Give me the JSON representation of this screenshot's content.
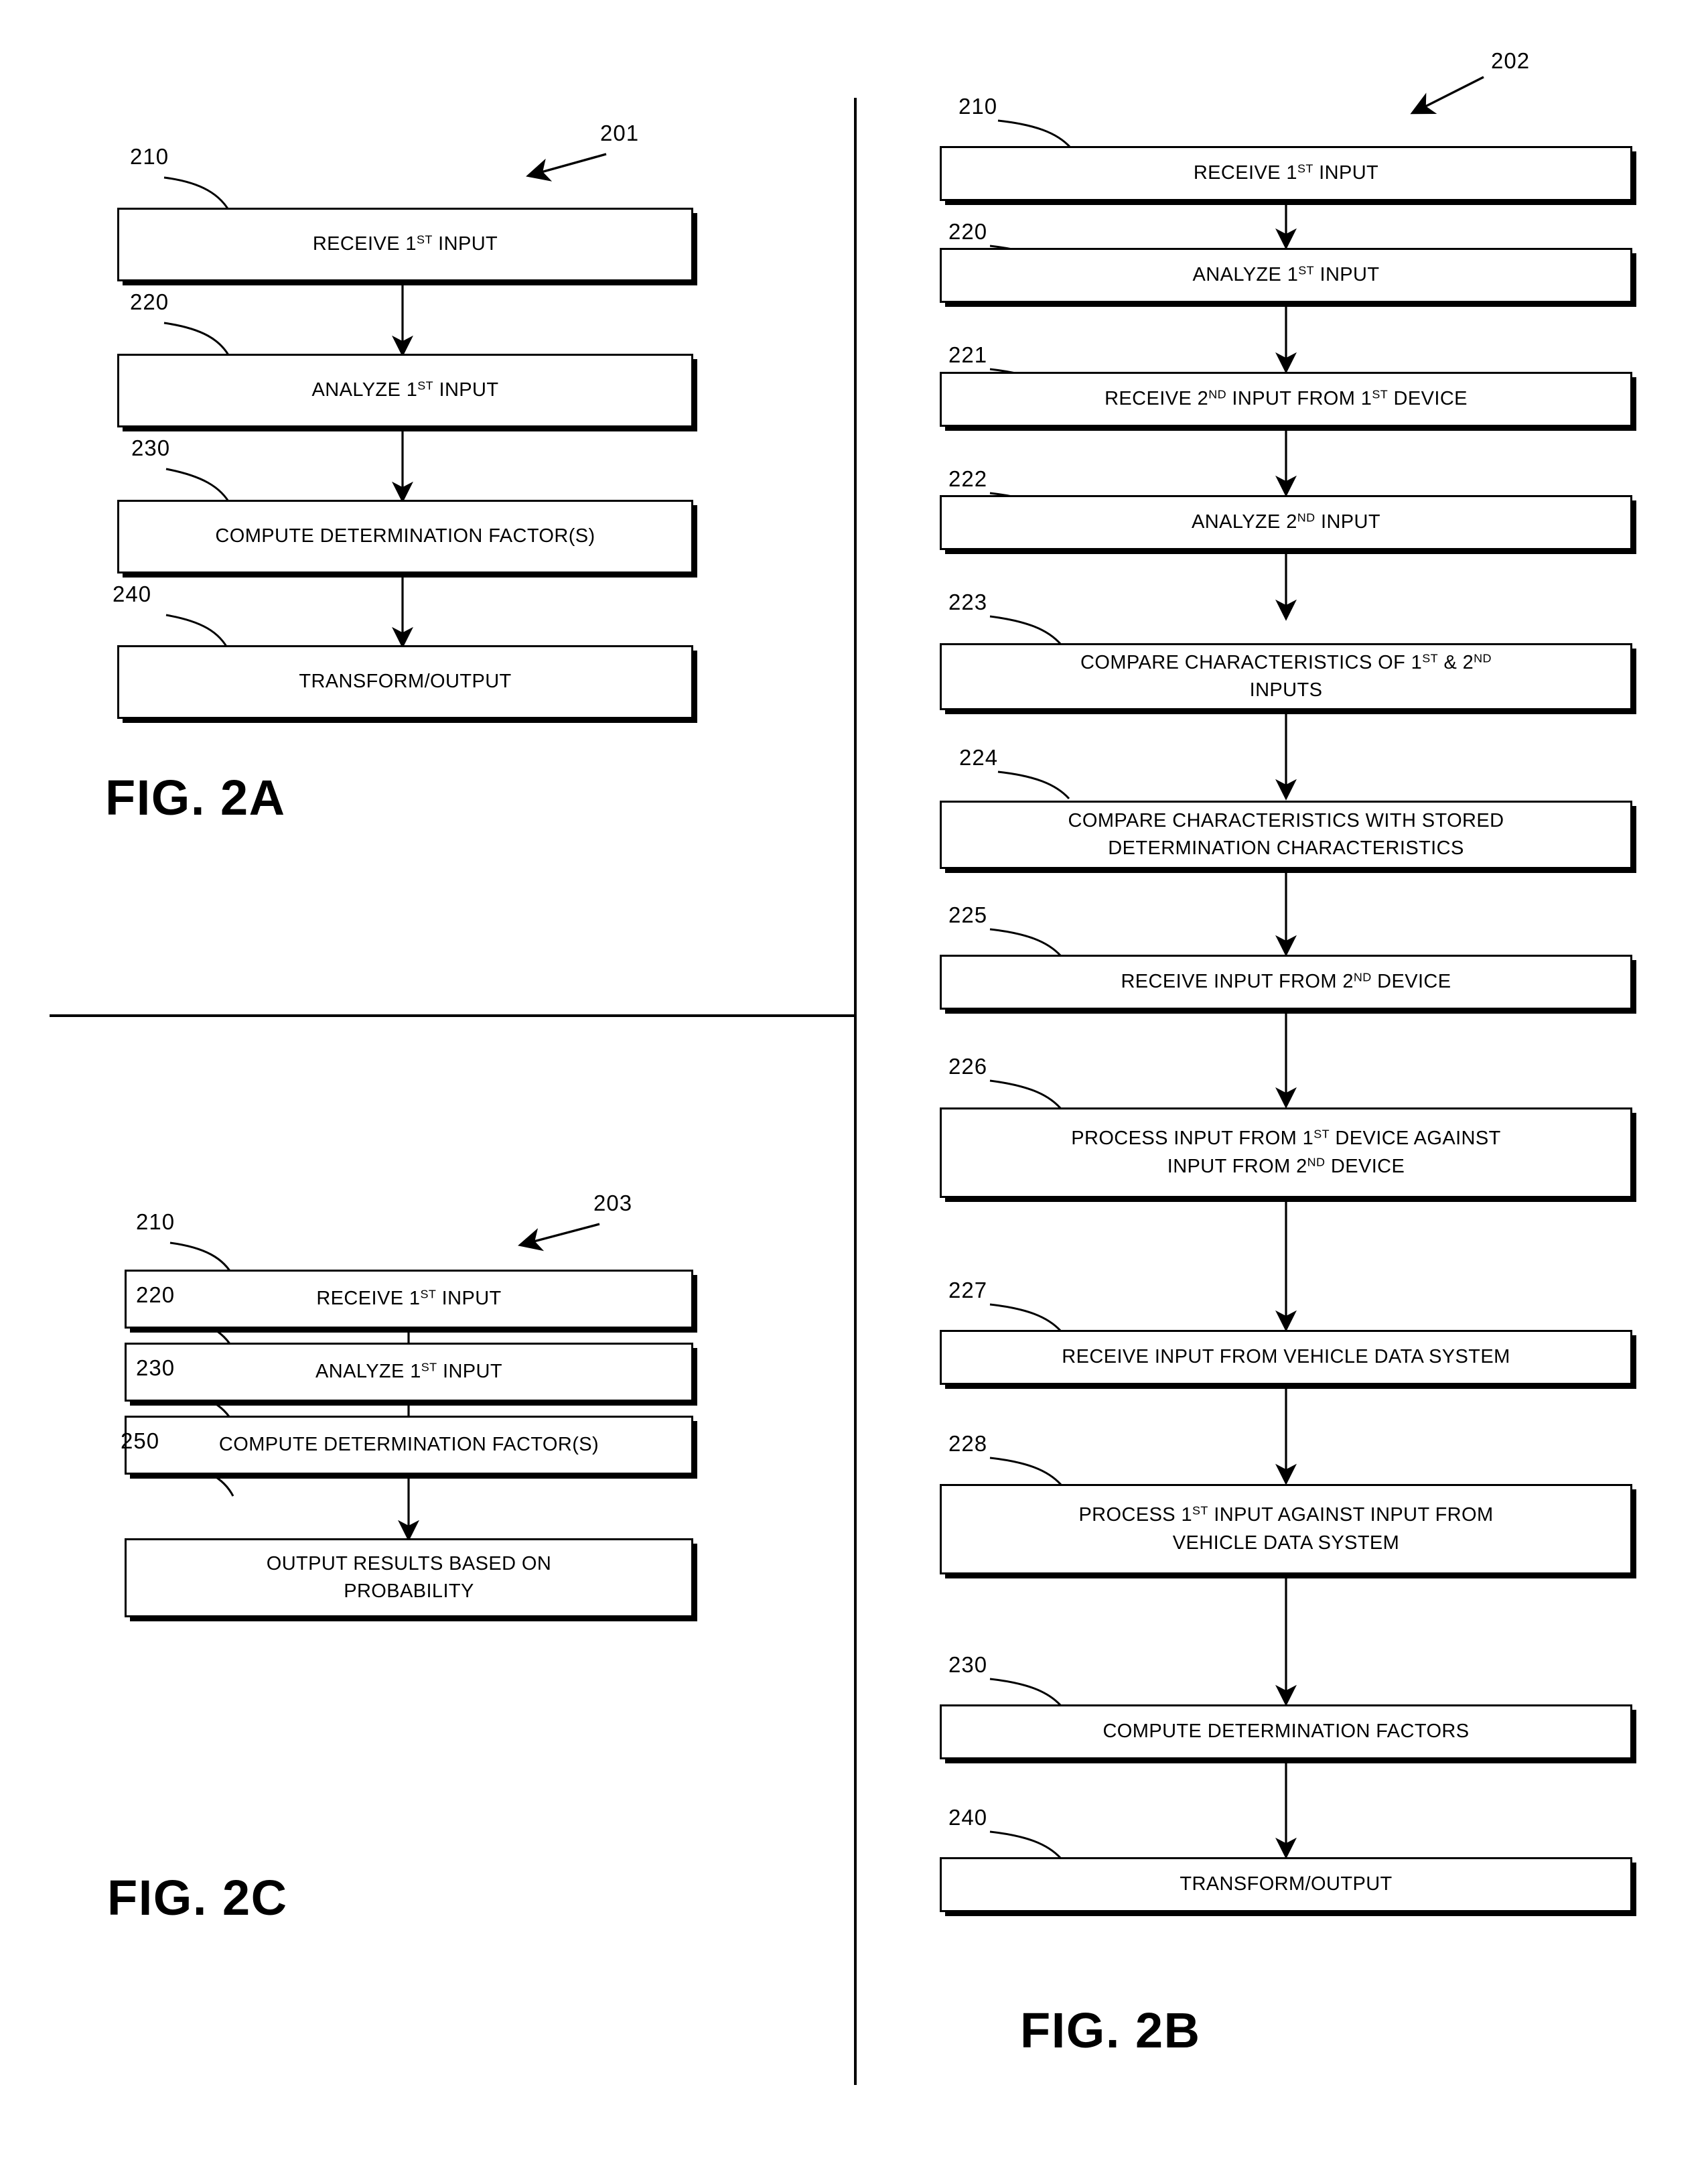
{
  "document": {
    "type": "patent-figure-sheet",
    "figures": [
      "FIG. 2A",
      "FIG. 2B",
      "FIG. 2C"
    ]
  },
  "fig2a": {
    "caption": "FIG. 2A",
    "flow_numeral": "201",
    "steps": [
      {
        "num": "210",
        "label": "RECEIVE 1ST INPUT",
        "html": "RECEIVE 1<sup>ST</sup> INPUT"
      },
      {
        "num": "220",
        "label": "ANALYZE 1ST INPUT",
        "html": "ANALYZE 1<sup>ST</sup> INPUT"
      },
      {
        "num": "230",
        "label": "COMPUTE DETERMINATION FACTOR(S)",
        "html": "COMPUTE DETERMINATION FACTOR(S)"
      },
      {
        "num": "240",
        "label": "TRANSFORM/OUTPUT",
        "html": "TRANSFORM/OUTPUT"
      }
    ]
  },
  "fig2b": {
    "caption": "FIG. 2B",
    "flow_numeral": "202",
    "steps": [
      {
        "num": "210",
        "label": "RECEIVE 1ST INPUT",
        "html": "RECEIVE 1<sup>ST</sup> INPUT"
      },
      {
        "num": "220",
        "label": "ANALYZE 1ST INPUT",
        "html": "ANALYZE 1<sup>ST</sup> INPUT"
      },
      {
        "num": "221",
        "label": "RECEIVE 2ND INPUT FROM 1ST DEVICE",
        "html": "RECEIVE 2<sup>ND</sup> INPUT FROM 1<sup>ST</sup> DEVICE"
      },
      {
        "num": "222",
        "label": "ANALYZE 2ND INPUT",
        "html": "ANALYZE 2<sup>ND</sup> INPUT"
      },
      {
        "num": "223",
        "label": "COMPARE CHARACTERISTICS OF 1ST & 2ND INPUTS",
        "html": "COMPARE CHARACTERISTICS OF 1<sup>ST</sup> &amp; 2<sup>ND</sup><br>INPUTS"
      },
      {
        "num": "224",
        "label": "COMPARE CHARACTERISTICS WITH STORED DETERMINATION CHARACTERISTICS",
        "html": "COMPARE CHARACTERISTICS WITH STORED<br>DETERMINATION CHARACTERISTICS"
      },
      {
        "num": "225",
        "label": "RECEIVE INPUT FROM 2ND DEVICE",
        "html": "RECEIVE INPUT FROM 2<sup>ND</sup> DEVICE"
      },
      {
        "num": "226",
        "label": "PROCESS INPUT FROM 1ST DEVICE AGAINST INPUT FROM 2ND DEVICE",
        "html": "PROCESS INPUT FROM 1<sup>ST</sup> DEVICE AGAINST<br>INPUT FROM 2<sup>ND</sup> DEVICE"
      },
      {
        "num": "227",
        "label": "RECEIVE INPUT FROM VEHICLE DATA SYSTEM",
        "html": "RECEIVE INPUT FROM VEHICLE DATA SYSTEM"
      },
      {
        "num": "228",
        "label": "PROCESS 1ST INPUT AGAINST INPUT FROM VEHICLE DATA SYSTEM",
        "html": "PROCESS 1<sup>ST</sup> INPUT AGAINST INPUT FROM<br>VEHICLE DATA SYSTEM"
      },
      {
        "num": "230",
        "label": "COMPUTE DETERMINATION FACTORS",
        "html": "COMPUTE DETERMINATION FACTORS"
      },
      {
        "num": "240",
        "label": "TRANSFORM/OUTPUT",
        "html": "TRANSFORM/OUTPUT"
      }
    ]
  },
  "fig2c": {
    "caption": "FIG. 2C",
    "flow_numeral": "203",
    "steps": [
      {
        "num": "210",
        "label": "RECEIVE 1ST INPUT",
        "html": "RECEIVE 1<sup>ST</sup> INPUT"
      },
      {
        "num": "220",
        "label": "ANALYZE 1ST INPUT",
        "html": "ANALYZE 1<sup>ST</sup> INPUT"
      },
      {
        "num": "230",
        "label": "COMPUTE DETERMINATION FACTOR(S)",
        "html": "COMPUTE DETERMINATION FACTOR(S)"
      },
      {
        "num": "250",
        "label": "OUTPUT RESULTS BASED ON PROBABILITY",
        "html": "OUTPUT RESULTS BASED ON<br>PROBABILITY"
      }
    ]
  },
  "colors": {
    "ink": "#000000",
    "paper": "#ffffff"
  }
}
